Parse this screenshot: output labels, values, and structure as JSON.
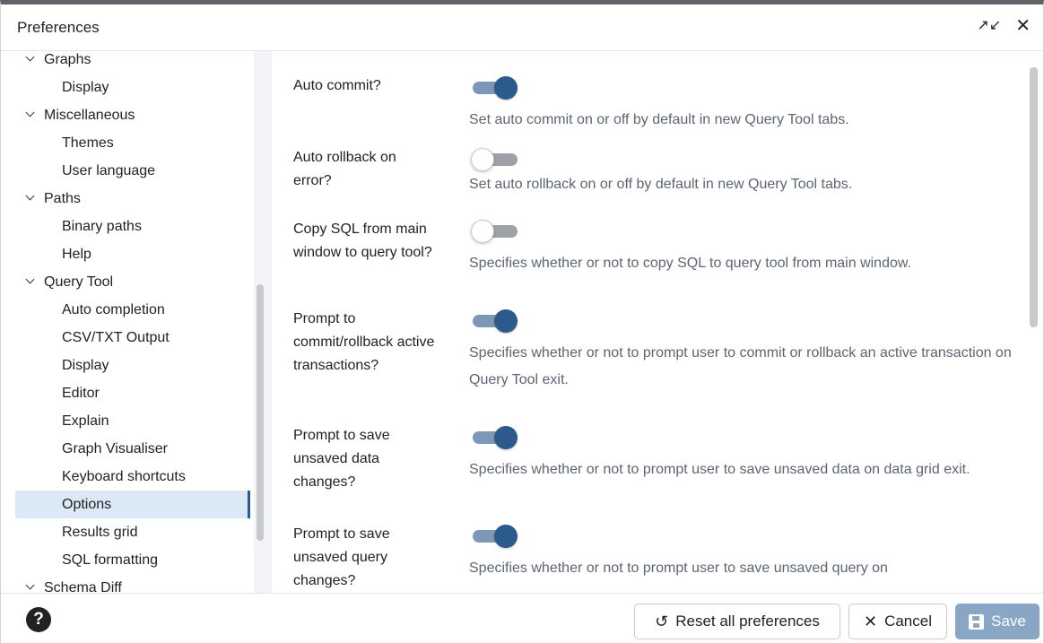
{
  "window": {
    "title": "Preferences",
    "expand_icon": "↗↙",
    "close_icon": "✕"
  },
  "tree": [
    {
      "label": "Graphs",
      "type": "group"
    },
    {
      "label": "Display",
      "type": "leaf"
    },
    {
      "label": "Miscellaneous",
      "type": "group"
    },
    {
      "label": "Themes",
      "type": "leaf"
    },
    {
      "label": "User language",
      "type": "leaf"
    },
    {
      "label": "Paths",
      "type": "group"
    },
    {
      "label": "Binary paths",
      "type": "leaf"
    },
    {
      "label": "Help",
      "type": "leaf"
    },
    {
      "label": "Query Tool",
      "type": "group"
    },
    {
      "label": "Auto completion",
      "type": "leaf"
    },
    {
      "label": "CSV/TXT Output",
      "type": "leaf"
    },
    {
      "label": "Display",
      "type": "leaf"
    },
    {
      "label": "Editor",
      "type": "leaf"
    },
    {
      "label": "Explain",
      "type": "leaf"
    },
    {
      "label": "Graph Visualiser",
      "type": "leaf"
    },
    {
      "label": "Keyboard shortcuts",
      "type": "leaf"
    },
    {
      "label": "Options",
      "type": "leaf",
      "selected": true
    },
    {
      "label": "Results grid",
      "type": "leaf"
    },
    {
      "label": "SQL formatting",
      "type": "leaf"
    },
    {
      "label": "Schema Diff",
      "type": "group"
    }
  ],
  "settings": [
    {
      "label": "Auto commit?",
      "on": true,
      "help": "Set auto commit on or off by default in new Query Tool tabs."
    },
    {
      "label": "Auto rollback on error?",
      "on": false,
      "help": "Set auto rollback on or off by default in new Query Tool tabs."
    },
    {
      "label": "Copy SQL from main window to query tool?",
      "on": false,
      "help": "Specifies whether or not to copy SQL to query tool from main window."
    },
    {
      "label": "Prompt to commit/rollback active transactions?",
      "on": true,
      "help": "Specifies whether or not to prompt user to commit or rollback an active transaction on Query Tool exit."
    },
    {
      "label": "Prompt to save unsaved data changes?",
      "on": true,
      "help": "Specifies whether or not to prompt user to save unsaved data on data grid exit."
    },
    {
      "label": "Prompt to save unsaved query changes?",
      "on": true,
      "help": "Specifies whether or not to prompt user to save unsaved query on"
    }
  ],
  "footer": {
    "help_label": "?",
    "reset_label": "Reset all preferences",
    "cancel_label": "Cancel",
    "save_label": "Save",
    "reset_icon": "↺",
    "cancel_icon": "✕"
  }
}
